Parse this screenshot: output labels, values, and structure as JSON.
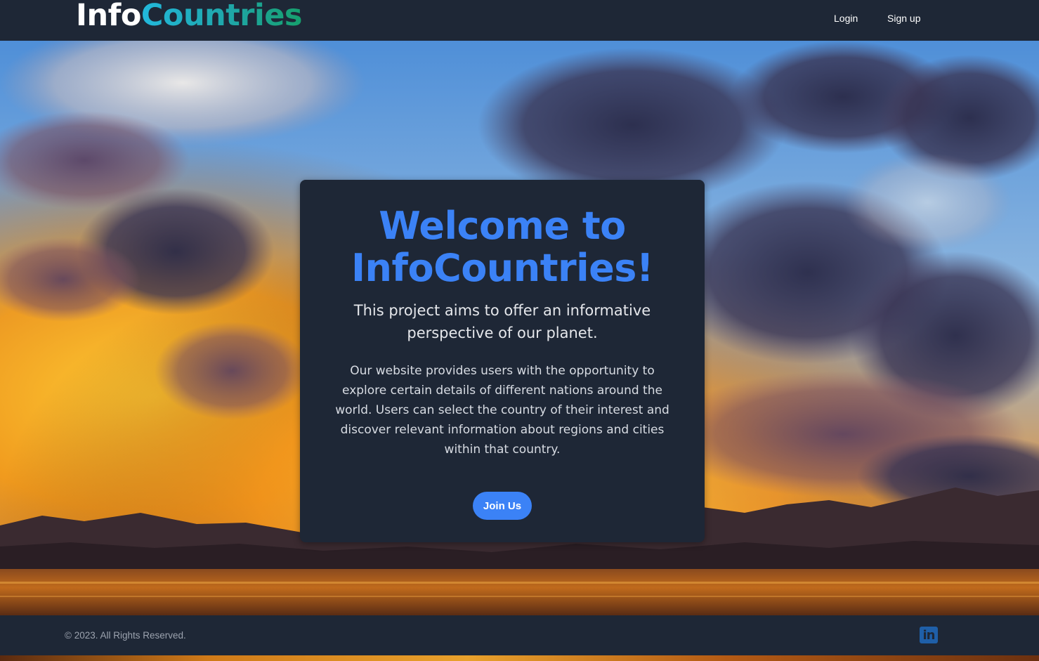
{
  "header": {
    "logo": {
      "part_a": "Info",
      "part_b": "Countries"
    },
    "nav": {
      "login": "Login",
      "signup": "Sign up"
    }
  },
  "card": {
    "title": "Welcome to InfoCountries!",
    "subtitle": "This project aims to offer an informative perspective of our planet.",
    "body": "Our website provides users with the opportunity to explore certain details of different nations around the world. Users can select the country of their interest and discover relevant information about regions and cities within that country.",
    "button": "Join Us"
  },
  "footer": {
    "copyright": "© 2023. All Rights Reserved.",
    "social_icon": "linkedin-icon"
  },
  "colors": {
    "navbar_bg": "#1e2736",
    "accent_blue": "#3b82f6",
    "logo_gradient_start": "#22b8dc",
    "logo_gradient_end": "#16a06d"
  }
}
